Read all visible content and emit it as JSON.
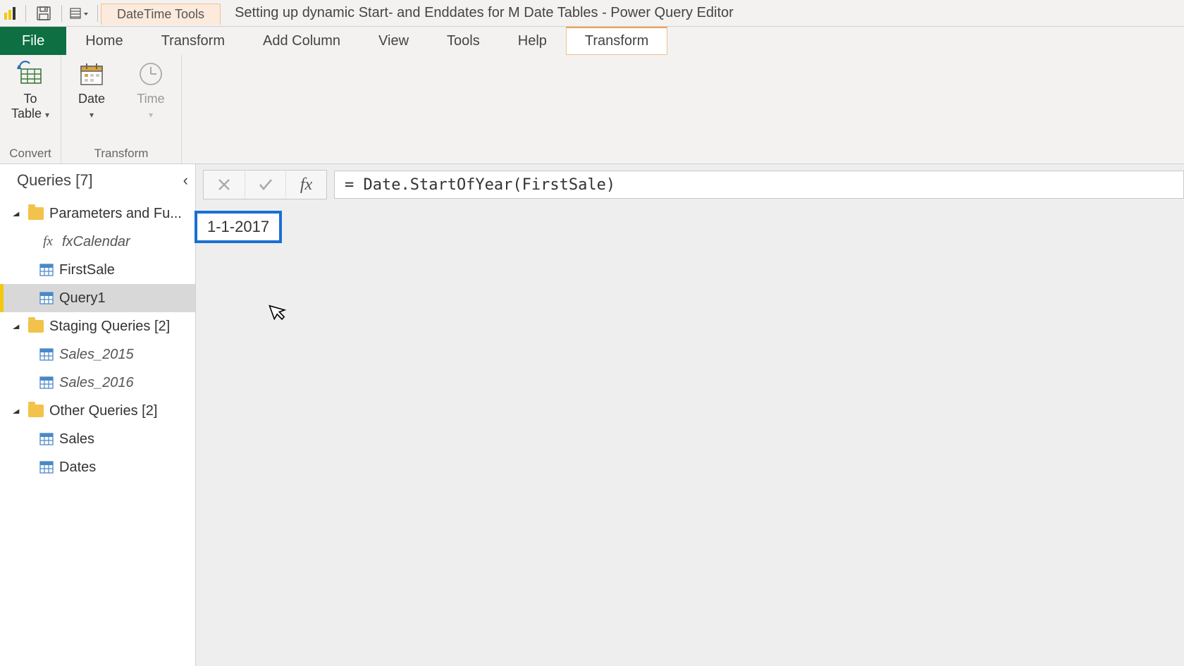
{
  "titlebar": {
    "context_tab_title": "DateTime Tools",
    "window_title": "Setting up dynamic Start- and Enddates for M Date Tables - Power Query Editor"
  },
  "tabs": {
    "file": "File",
    "home": "Home",
    "transform": "Transform",
    "add_column": "Add Column",
    "view": "View",
    "tools": "Tools",
    "help": "Help",
    "context_transform": "Transform"
  },
  "ribbon": {
    "convert": {
      "to_table": "To\nTable",
      "group_label": "Convert"
    },
    "transform": {
      "date": "Date",
      "time": "Time",
      "group_label": "Transform"
    }
  },
  "queries_pane": {
    "header": "Queries [7]",
    "folders": [
      {
        "name": "Parameters and Fu...",
        "items": [
          {
            "label": "fxCalendar",
            "kind": "fx",
            "italic": true
          },
          {
            "label": "FirstSale",
            "kind": "table",
            "italic": false
          },
          {
            "label": "Query1",
            "kind": "table",
            "italic": false,
            "selected": true
          }
        ]
      },
      {
        "name": "Staging Queries [2]",
        "items": [
          {
            "label": "Sales_2015",
            "kind": "table",
            "italic": true
          },
          {
            "label": "Sales_2016",
            "kind": "table",
            "italic": true
          }
        ]
      },
      {
        "name": "Other Queries [2]",
        "items": [
          {
            "label": "Sales",
            "kind": "table",
            "italic": false
          },
          {
            "label": "Dates",
            "kind": "table",
            "italic": false
          }
        ]
      }
    ]
  },
  "formula_bar": {
    "expression": "= Date.StartOfYear(FirstSale)"
  },
  "result": {
    "value": "1-1-2017"
  }
}
